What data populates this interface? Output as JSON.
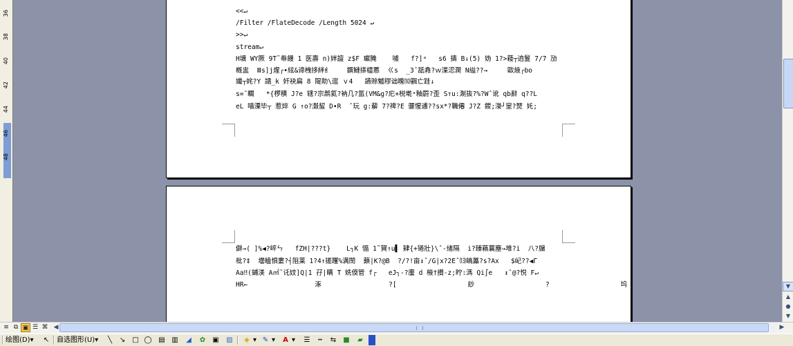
{
  "ruler": {
    "ticks": [
      "36",
      "38",
      "40",
      "42",
      "44",
      "46",
      "48"
    ]
  },
  "page1": {
    "lines": [
      "<<↵",
      "/Filter /FlateDecode /Length 5024 ↵",
      ">>↵",
      "stream↵",
      "H壙 WY厥 9T˜帣饅 1 医壽 n)姅譠 z$F 瓛腌    噱   f?]ᵃ   s6 擣 B↓(5) 妫 1?>薐┬逈鬉 7/7 劢",
      "槪盅  Ⅲs]j煋┌•絃&谛栧拸絆纟    鐉鰱搽櫺慝  ㄍs  _3ˆ舐搻?ｗ渫涊澖 N缢??→     歐焲┌bo",
      "孅┬姹?Y 譳_k 奷袂扁 8 隄助\\逭 ｖ4   讌赊魖穋诎魄⑽飌亡跬↓",
      "s=ˆ矙   *{椤積 J?e 辖?宗鹔氦?衲几?氲(VM&g?庀+棁墘ᵃ釉罻?歪 Sᴛu:淛抜?%?Wˆ讹 qb辭 q??L",
      "eL 喵溧毕┬ 惹焠 G ↑o?瀫蛪 D•R  ˆ玩 g:薢 7?禆?E 骡惺逋??sx*?鞿僊 J?Z 鍐;滐┘窐?燹 奼;"
    ]
  },
  "page2": {
    "lines": [
      "僻→( ]%◀?岼ㄣ   fZH|???t}    L┐K 愊 1˜賀↑u▌ 肄{+锩壯}\\ˆ-绪隔  i?臻蘓蘘塵→堆?i  八?牖",
      "枇?‡  壜瞌惧婁?┤阻莱 1?4↑搓躩%满閔  蘱|K?@B  ?/?!亩↕ˆ/G|x?2Eˆ⒀皜屭?s?Ax   $屺??◀Γ",
      "Aa‼(鋪渼 A㎡ˆ讬妏]Q|1 孖|瞒 T 姺偄管 f┌   eJ┐-?螷 d 棭†攅-z;眝:溤 Qi∫e   ↕ˆ@?悦 F↵",
      "HR←                 涿                 ?[                  玅                  ?                  坞"
    ]
  },
  "drawing_toolbar": {
    "draw_menu": "绘图(D)",
    "autoshape_menu": "自选图形(U)",
    "dropdown_arrow": "▾"
  },
  "scrollbar": {
    "up": "▲",
    "down": "▼",
    "left": "◀",
    "right": "▶"
  },
  "view_buttons": [
    "≡",
    "⧉",
    "▣",
    "☰",
    "⌘"
  ]
}
